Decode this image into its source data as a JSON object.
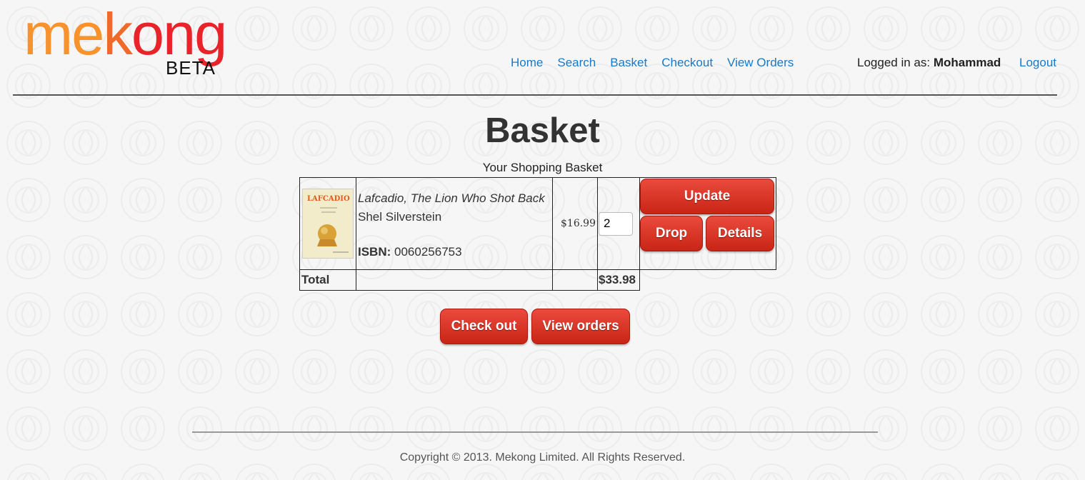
{
  "logo": {
    "me": "me",
    "k": "k",
    "ong": "ong",
    "beta": "BETA"
  },
  "nav": {
    "home": "Home",
    "search": "Search",
    "basket": "Basket",
    "checkout": "Checkout",
    "view_orders": "View Orders"
  },
  "user": {
    "prefix": "Logged in as:",
    "name": "Mohammad",
    "logout": "Logout"
  },
  "page": {
    "title": "Basket",
    "subtitle": "Your Shopping Basket"
  },
  "basket": {
    "items": [
      {
        "title": "Lafcadio, The Lion Who Shot Back",
        "author": "Shel Silverstein",
        "isbn_label": "ISBN:",
        "isbn": "0060256753",
        "price": "$16.99",
        "quantity": "2",
        "cover_text": "LAFCADIO"
      }
    ],
    "total_label": "Total",
    "total_value": "$33.98"
  },
  "buttons": {
    "update": "Update",
    "drop": "Drop",
    "details": "Details",
    "check_out": "Check out",
    "view_orders": "View orders"
  },
  "footer": {
    "copyright": "Copyright © 2013. Mekong Limited. All Rights Reserved."
  },
  "colors": {
    "link": "#1a79c5",
    "button": "#d8322a",
    "logo_orange": "#f7922d",
    "logo_red": "#e8232a"
  }
}
